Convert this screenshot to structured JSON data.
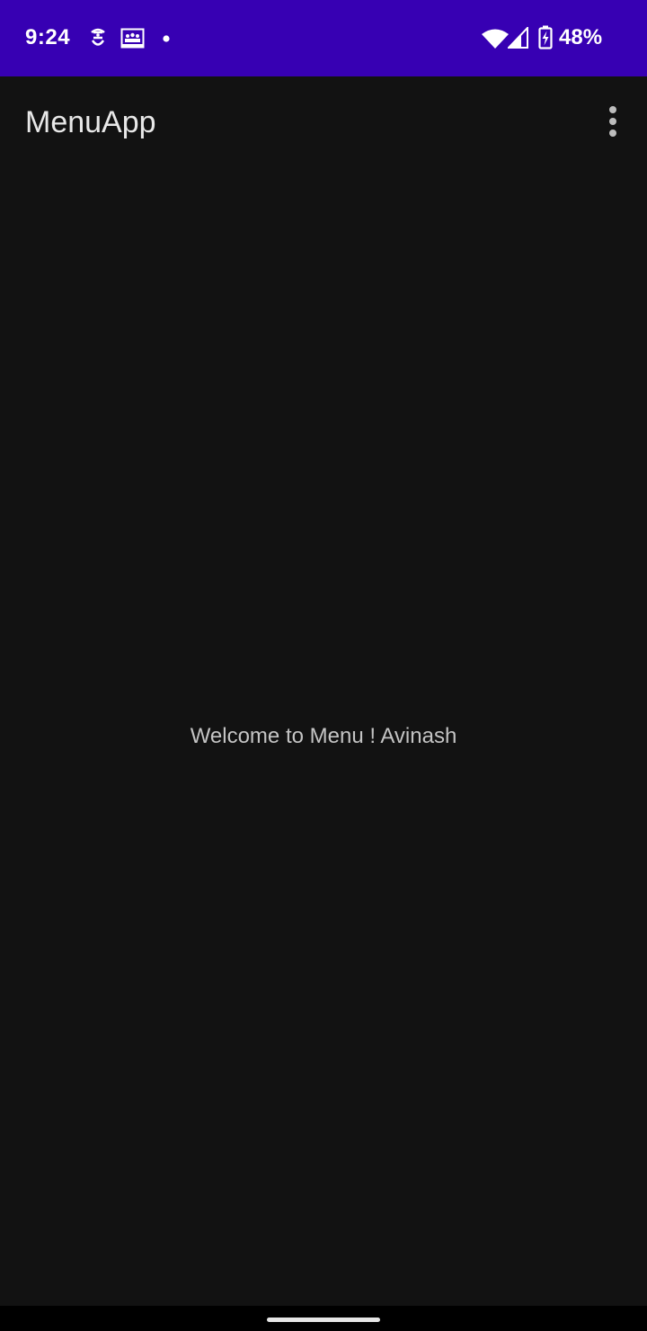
{
  "status_bar": {
    "time": "9:24",
    "battery_percent": "48%",
    "icons": [
      "notification-a-icon",
      "gallery-notification-icon",
      "notification-dot-icon",
      "wifi-icon",
      "cellular-signal-icon",
      "battery-charging-icon"
    ],
    "background_color": "#3700b3"
  },
  "app_bar": {
    "title": "MenuApp",
    "overflow_icon": "more-vert-icon"
  },
  "main": {
    "welcome_text": "Welcome to Menu ! Avinash"
  },
  "theme": {
    "background": "#121212",
    "text_primary": "#e8e8e8",
    "text_secondary": "#c4c4c4"
  }
}
